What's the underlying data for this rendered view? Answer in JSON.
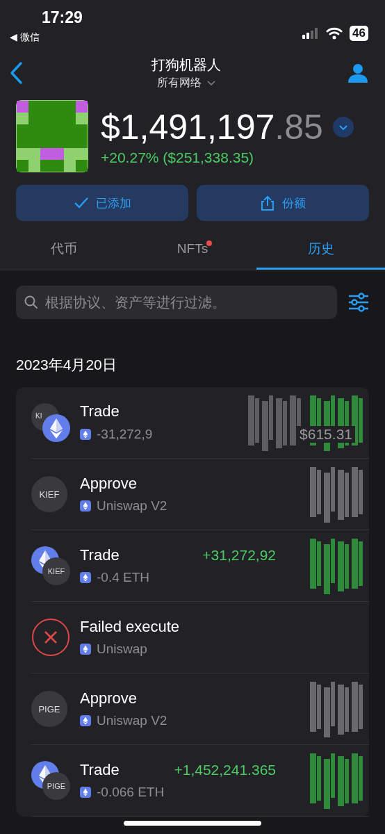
{
  "status_bar": {
    "time": "17:29",
    "back_app": "◀ 微信",
    "battery": "46"
  },
  "nav": {
    "title": "打狗机器人",
    "network": "所有网络"
  },
  "balance": {
    "whole": "$1,491,197",
    "cents": ".85",
    "change": "+20.27% ($251,338.35)"
  },
  "actions": [
    {
      "label": "已添加",
      "kind": "check"
    },
    {
      "label": "份额",
      "kind": "share"
    }
  ],
  "tabs": [
    {
      "label": "代币",
      "selected": false,
      "dot": false
    },
    {
      "label": "NFTs",
      "selected": false,
      "dot": true
    },
    {
      "label": "历史",
      "selected": true,
      "dot": false
    }
  ],
  "search": {
    "placeholder": "根据协议、资产等进行过滤。"
  },
  "date": "2023年4月20日",
  "rows": [
    {
      "icon": {
        "kind": "pair",
        "back": {
          "kind": "token",
          "label": "KI"
        },
        "front": {
          "kind": "eth"
        }
      },
      "title": "Trade",
      "subtitle": "-31,272,9",
      "amount": "$615.31",
      "positive": false,
      "scribbles": [
        {
          "color": "#5e5e62"
        },
        {
          "color": "#2f8a3c"
        }
      ]
    },
    {
      "icon": {
        "kind": "token",
        "label": "KIEF"
      },
      "title": "Approve",
      "subtitle": "Uniswap V2",
      "scribbles": [
        {
          "color": "#6a6a6e"
        }
      ]
    },
    {
      "icon": {
        "kind": "pair",
        "back": {
          "kind": "eth"
        },
        "front": {
          "kind": "token",
          "label": "KIEF"
        }
      },
      "title": "Trade",
      "subtitle": "-0.4 ETH",
      "amount": "+31,272,92",
      "positive": true,
      "scribbles": [
        {
          "color": "#2f8a3c"
        }
      ]
    },
    {
      "icon": {
        "kind": "failed"
      },
      "title": "Failed execute",
      "subtitle": "Uniswap"
    },
    {
      "icon": {
        "kind": "token",
        "label": "PIGE"
      },
      "title": "Approve",
      "subtitle": "Uniswap V2",
      "scribbles": [
        {
          "color": "#6a6a6e"
        }
      ]
    },
    {
      "icon": {
        "kind": "pair",
        "back": {
          "kind": "eth"
        },
        "front": {
          "kind": "token",
          "label": "PIGE"
        }
      },
      "title": "Trade",
      "subtitle": "-0.066 ETH",
      "amount": "+1,452,241.365",
      "positive": true,
      "scribbles": [
        {
          "color": "#2f8a3c"
        }
      ]
    }
  ]
}
